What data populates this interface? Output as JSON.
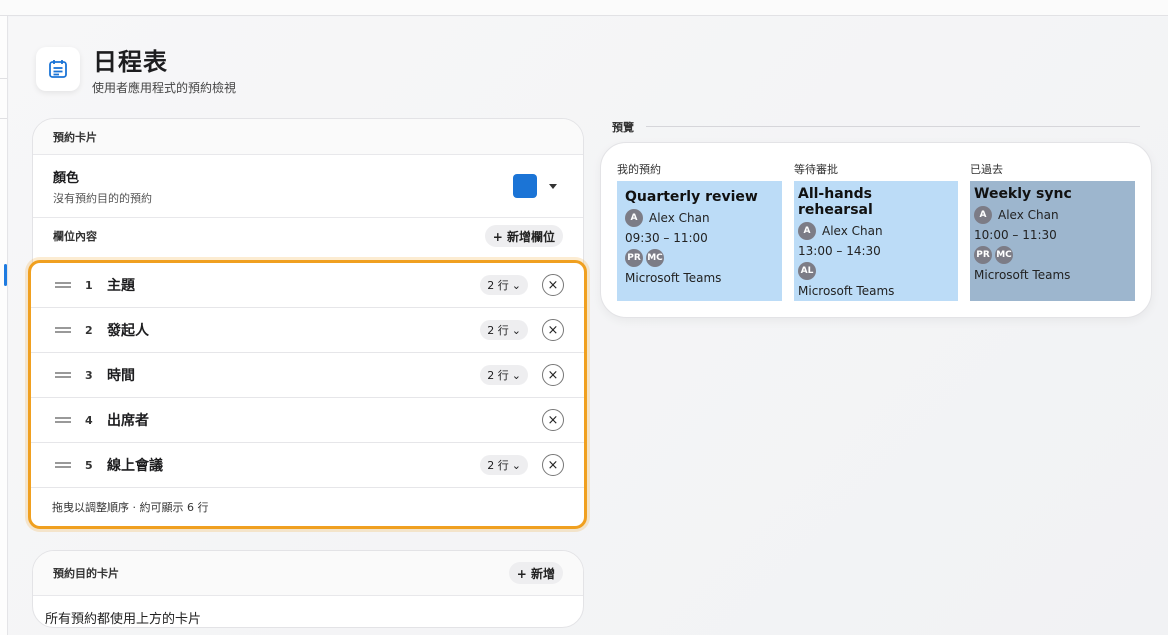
{
  "header": {
    "title": "日程表",
    "subtitle": "使用者應用程式的預約檢視",
    "icon": "calendar-icon"
  },
  "booking_card": {
    "heading": "預約卡片",
    "color": {
      "label": "顏色",
      "description": "沒有預約目的的預約",
      "value": "#1b74d6"
    },
    "fields_heading": "欄位內容",
    "add_field_label": "+ 新增欄位",
    "fields": [
      {
        "num": "1",
        "name": "主題",
        "rows": "2 行"
      },
      {
        "num": "2",
        "name": "發起人",
        "rows": "2 行"
      },
      {
        "num": "3",
        "name": "時間",
        "rows": "2 行"
      },
      {
        "num": "4",
        "name": "出席者",
        "rows": ""
      },
      {
        "num": "5",
        "name": "線上會議",
        "rows": "2 行"
      }
    ],
    "hint": "拖曳以調整順序 · 約可顯示 6 行"
  },
  "purpose_card": {
    "heading": "預約目的卡片",
    "add_label": "+ 新增",
    "body": "所有預約都使用上方的卡片"
  },
  "preview": {
    "label": "預覽",
    "columns": [
      {
        "label": "我的預約",
        "bg": "#bcdcf7",
        "title": "Quarterly review",
        "organizer_initial": "A",
        "organizer": "Alex Chan",
        "time": "09:30 – 11:00",
        "attendees": [
          "PR",
          "MC"
        ],
        "meeting": "Microsoft Teams"
      },
      {
        "label": "等待審批",
        "bg": "#bcdcf7",
        "title": "All-hands rehearsal",
        "organizer_initial": "A",
        "organizer": "Alex Chan",
        "time": "13:00 – 14:30",
        "attendees": [
          "AL"
        ],
        "meeting": "Microsoft Teams"
      },
      {
        "label": "已過去",
        "bg": "#9db6ce",
        "title": "Weekly sync",
        "organizer_initial": "A",
        "organizer": "Alex Chan",
        "time": "10:00 – 11:30",
        "attendees": [
          "PR",
          "MC"
        ],
        "meeting": "Microsoft Teams"
      }
    ]
  }
}
